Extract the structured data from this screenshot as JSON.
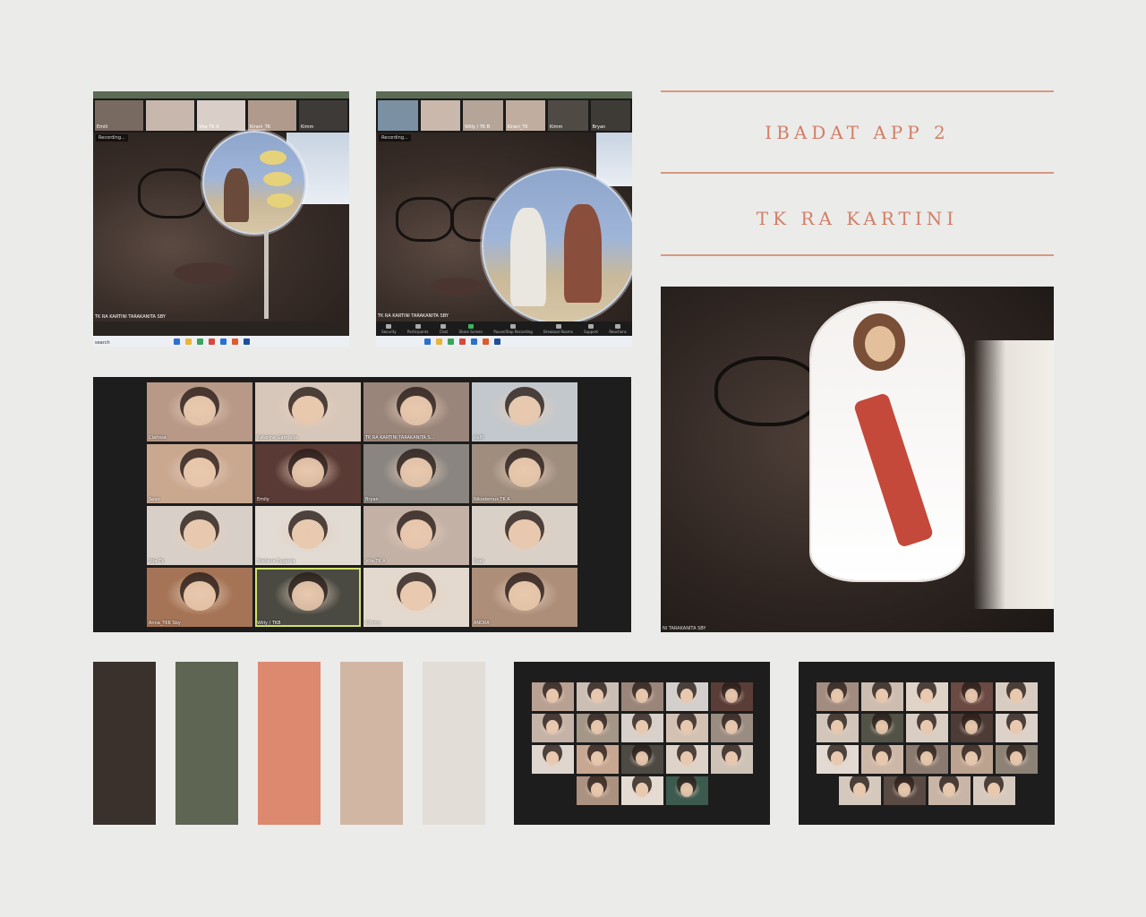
{
  "titles": {
    "line1": "IBADAT APP 2",
    "line2": "TK RA KARTINI"
  },
  "palette": [
    "#3a312c",
    "#5e6553",
    "#dc8970",
    "#d1b6a4",
    "#e2ddd7"
  ],
  "zoom_shot_1": {
    "recording_label": "Recording...",
    "meeting_label": "TK RA KARTINI TARAKANITA SBY",
    "search_label": "search",
    "thumbs": [
      "Emili",
      "",
      "Vita TK A",
      "Kirani_TK",
      "Kimm"
    ]
  },
  "zoom_shot_2": {
    "recording_label": "Recording...",
    "meeting_label": "TK RA KARTINI TARAKANITA SBY",
    "thumbs": [
      "",
      "",
      "Willy / TK B",
      "Kirani_TK",
      "Kimm",
      "Bryan"
    ],
    "toolbar": [
      "Security",
      "Participants",
      "Chat",
      "Share Screen",
      "Pause/Stop Recording",
      "Breakout Rooms",
      "Support",
      "Reactions"
    ]
  },
  "big_video": {
    "label": "NI TARAKANITA SBY"
  },
  "main_gallery": {
    "tiles": [
      {
        "name": "Clarissa",
        "color": "#b89886"
      },
      {
        "name": "Katerine Gabriella",
        "color": "#d7c7ba"
      },
      {
        "name": "TK RA KARTINI TARAKANITA S...",
        "color": "#9a857a"
      },
      {
        "name": "Rafif",
        "color": "#c3c8cc"
      },
      {
        "name": "Sean",
        "color": "#caa890"
      },
      {
        "name": "Emily",
        "color": "#5a3a34"
      },
      {
        "name": "Bryan",
        "color": "#8a8580"
      },
      {
        "name": "Nikodemus TK A",
        "color": "#9f8d7e"
      },
      {
        "name": "Vita Tk",
        "color": "#d8cfc8"
      },
      {
        "name": "Stefanie Eugenia",
        "color": "#e1dbd4"
      },
      {
        "name": "Vita TK A",
        "color": "#c3b1a6"
      },
      {
        "name": "Noel",
        "color": "#d9d0c8"
      },
      {
        "name": "Anna_TKK Sby",
        "color": "#a57456"
      },
      {
        "name": "Willy / TKB",
        "color": "#4a4a42"
      },
      {
        "name": "Kimmy",
        "color": "#e4d9cf"
      },
      {
        "name": "ANDRA",
        "color": "#ad8e79"
      }
    ]
  },
  "gallery_small_1": {
    "tiles": [
      {
        "name": "",
        "color": "#b8a093"
      },
      {
        "name": "",
        "color": "#cbbfb5"
      },
      {
        "name": "",
        "color": "#9a857a"
      },
      {
        "name": "",
        "color": "#d2cfcc"
      },
      {
        "name": "",
        "color": "#5a3d37"
      },
      {
        "name": "",
        "color": "#c5b3a8"
      },
      {
        "name": "",
        "color": "#a59787"
      },
      {
        "name": "",
        "color": "#d8d0ca"
      },
      {
        "name": "",
        "color": "#d3c2b4"
      },
      {
        "name": "",
        "color": "#9a8c80"
      },
      {
        "name": "",
        "color": "#dfd6cf"
      },
      {
        "name": "",
        "color": "#c7a792"
      },
      {
        "name": "",
        "color": "#4d4a44"
      },
      {
        "name": "",
        "color": "#ded3c8"
      },
      {
        "name": "",
        "color": "#cfc3b8"
      },
      {
        "name": "",
        "color": "#ab917f"
      },
      {
        "name": "",
        "color": "#e4dbd3"
      },
      {
        "name": "",
        "color": "#3c5a4e"
      }
    ]
  },
  "gallery_small_2": {
    "tiles": [
      {
        "name": "",
        "color": "#a28c80"
      },
      {
        "name": "",
        "color": "#cdbdb0"
      },
      {
        "name": "",
        "color": "#e0d4c9"
      },
      {
        "name": "",
        "color": "#6a4a43"
      },
      {
        "name": "",
        "color": "#d8ccc2"
      },
      {
        "name": "",
        "color": "#d2c6bb"
      },
      {
        "name": "",
        "color": "#525246"
      },
      {
        "name": "",
        "color": "#d9cec4"
      },
      {
        "name": "",
        "color": "#4d3b36"
      },
      {
        "name": "",
        "color": "#dcd2ca"
      },
      {
        "name": "",
        "color": "#e3dbd3"
      },
      {
        "name": "",
        "color": "#cdb8a8"
      },
      {
        "name": "",
        "color": "#8a7a70"
      },
      {
        "name": "",
        "color": "#bca390"
      },
      {
        "name": "",
        "color": "#8d8276"
      },
      {
        "name": "",
        "color": "#d5c9be"
      },
      {
        "name": "",
        "color": "#5a4a44"
      },
      {
        "name": "",
        "color": "#c8b5a6"
      },
      {
        "name": "",
        "color": "#d6cabe"
      }
    ]
  }
}
